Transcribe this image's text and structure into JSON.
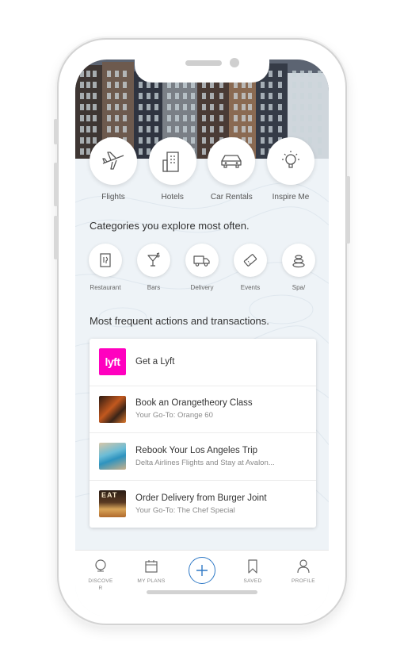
{
  "quick_actions": [
    {
      "label": "Flights",
      "icon": "airplane-icon"
    },
    {
      "label": "Hotels",
      "icon": "hotel-building-icon"
    },
    {
      "label": "Car Rentals",
      "icon": "car-icon"
    },
    {
      "label": "Inspire Me",
      "icon": "lightbulb-icon"
    }
  ],
  "categories": {
    "title": "Categories you explore most often.",
    "items": [
      {
        "label": "Restaurant",
        "icon": "menu-icon"
      },
      {
        "label": "Bars",
        "icon": "cocktail-icon"
      },
      {
        "label": "Delivery",
        "icon": "delivery-truck-icon"
      },
      {
        "label": "Events",
        "icon": "ticket-icon"
      },
      {
        "label": "Spa/",
        "icon": "spa-stones-icon"
      }
    ]
  },
  "frequent": {
    "title": "Most frequent actions and transactions.",
    "items": [
      {
        "title": "Get a Lyft",
        "subtitle": "",
        "logo_text": "lyft"
      },
      {
        "title": "Book an Orangetheory Class",
        "subtitle": "Your Go-To: Orange 60"
      },
      {
        "title": "Rebook Your Los Angeles Trip",
        "subtitle": "Delta Airlines Flights and Stay at Avalon..."
      },
      {
        "title": "Order Delivery from Burger Joint",
        "subtitle": "Your Go-To: The Chef Special",
        "thumb_text": "EAT"
      }
    ]
  },
  "tabbar": {
    "discover": "DISCOVER",
    "plans": "MY PLANS",
    "saved": "SAVED",
    "profile": "PROFILE"
  },
  "colors": {
    "accent": "#2f79c6",
    "lyft": "#ff00bf"
  }
}
